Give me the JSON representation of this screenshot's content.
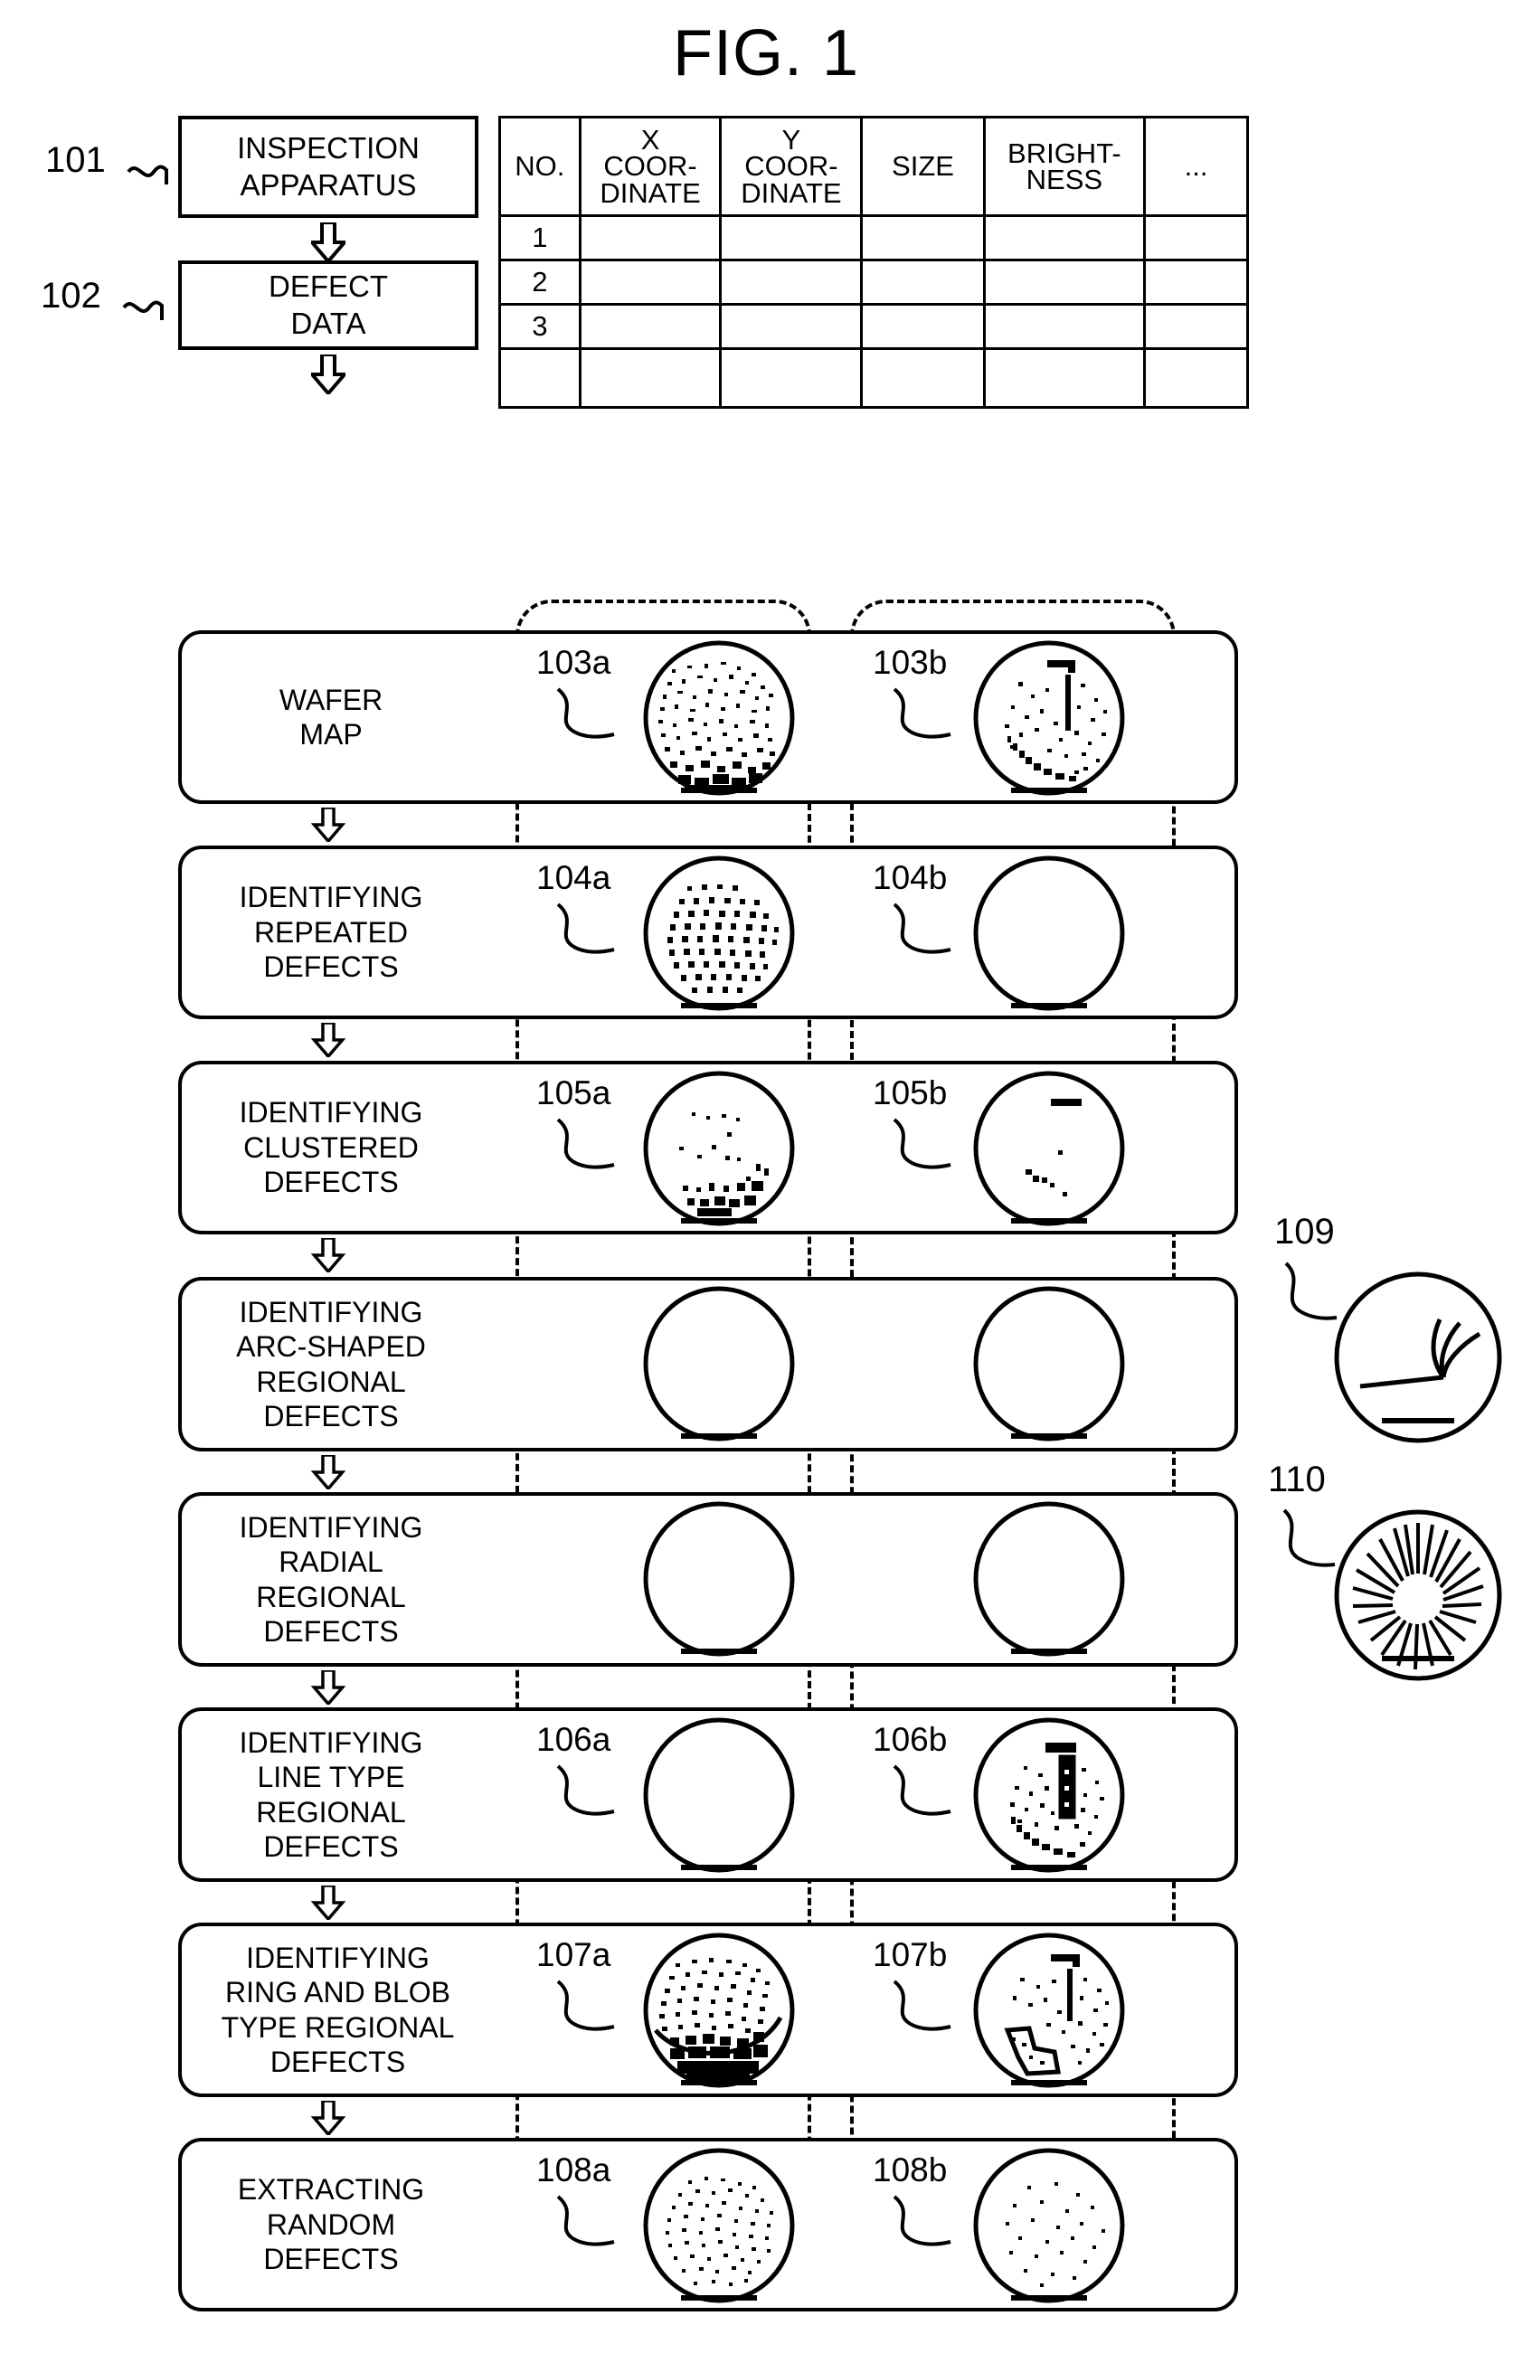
{
  "figure": {
    "title": "FIG. 1"
  },
  "table": {
    "name": "defect-data-table",
    "headers": [
      {
        "main": "NO.",
        "sup": ""
      },
      {
        "main": "COOR-\nDINATE",
        "sup": "X"
      },
      {
        "main": "COOR-\nDINATE",
        "sup": "Y"
      },
      {
        "main": "SIZE",
        "sup": ""
      },
      {
        "main": "BRIGHT-\nNESS",
        "sup": ""
      },
      {
        "main": "...",
        "sup": ""
      }
    ],
    "header_x": "X",
    "header_y": "Y",
    "header_no": "NO.",
    "header_coord1_l1": "COOR-",
    "header_coord1_l2": "DINATE",
    "header_coord2_l1": "COOR-",
    "header_coord2_l2": "DINATE",
    "header_size": "SIZE",
    "header_bright_l1": "BRIGHT-",
    "header_bright_l2": "NESS",
    "header_ellipsis": "...",
    "rows": [
      "1",
      "2",
      "3",
      ""
    ]
  },
  "blocks": [
    {
      "ref": "101",
      "label_l1": "INSPECTION",
      "label_l2": "APPARATUS"
    },
    {
      "ref": "102",
      "label_l1": "DEFECT",
      "label_l2": "DATA"
    }
  ],
  "steps": [
    {
      "lines": [
        "WAFER",
        "MAP"
      ],
      "left": {
        "ref": "103a",
        "pattern": "dense-random-heavy-bottom"
      },
      "right": {
        "ref": "103b",
        "pattern": "sparse-random-with-line-and-arc"
      }
    },
    {
      "lines": [
        "IDENTIFYING",
        "REPEATED",
        "DEFECTS"
      ],
      "left": {
        "ref": "104a",
        "pattern": "regular-grid"
      },
      "right": {
        "ref": "104b",
        "pattern": "empty"
      }
    },
    {
      "lines": [
        "IDENTIFYING",
        "CLUSTERED",
        "DEFECTS"
      ],
      "left": {
        "ref": "105a",
        "pattern": "sparse-top-cluster-bottom"
      },
      "right": {
        "ref": "105b",
        "pattern": "short-bar-few-dots"
      }
    },
    {
      "lines": [
        "IDENTIFYING",
        "ARC-SHAPED",
        "REGIONAL",
        "DEFECTS"
      ],
      "left": {
        "ref": "",
        "pattern": "empty"
      },
      "right": {
        "ref": "",
        "pattern": "empty"
      }
    },
    {
      "lines": [
        "IDENTIFYING",
        "RADIAL",
        "REGIONAL",
        "DEFECTS"
      ],
      "left": {
        "ref": "",
        "pattern": "empty"
      },
      "right": {
        "ref": "",
        "pattern": "empty"
      }
    },
    {
      "lines": [
        "IDENTIFYING",
        "LINE TYPE",
        "REGIONAL",
        "DEFECTS"
      ],
      "left": {
        "ref": "106a",
        "pattern": "empty"
      },
      "right": {
        "ref": "106b",
        "pattern": "vertical-line-region-plus-noise"
      }
    },
    {
      "lines": [
        "IDENTIFYING",
        "RING AND BLOB",
        "TYPE REGIONAL",
        "DEFECTS"
      ],
      "left": {
        "ref": "107a",
        "pattern": "dense-with-blob-bottom"
      },
      "right": {
        "ref": "107b",
        "pattern": "sparse-with-blob-outline"
      }
    },
    {
      "lines": [
        "EXTRACTING",
        "RANDOM",
        "DEFECTS"
      ],
      "left": {
        "ref": "108a",
        "pattern": "random-dense"
      },
      "right": {
        "ref": "108b",
        "pattern": "random-sparse"
      }
    }
  ],
  "side_examples": [
    {
      "ref": "109",
      "pattern": "arc-shaped-defect-example"
    },
    {
      "ref": "110",
      "pattern": "radial-defect-example"
    }
  ],
  "icons": {
    "down_arrow": "fat-down-arrow-icon",
    "leader": "leader-line-icon"
  }
}
